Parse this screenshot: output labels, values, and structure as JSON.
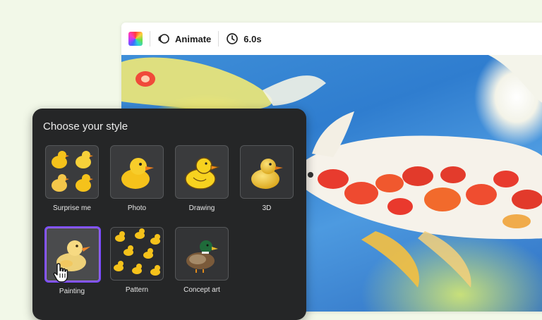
{
  "toolbar": {
    "animate_label": "Animate",
    "duration_label": "6.0s"
  },
  "panel": {
    "title": "Choose your style",
    "styles": [
      {
        "label": "Surprise me",
        "icon": "duck-collage-icon",
        "selected": false
      },
      {
        "label": "Photo",
        "icon": "photo-duck-icon",
        "selected": false
      },
      {
        "label": "Drawing",
        "icon": "drawn-duck-icon",
        "selected": false
      },
      {
        "label": "3D",
        "icon": "3d-duck-icon",
        "selected": false
      },
      {
        "label": "Painting",
        "icon": "painted-duck-icon",
        "selected": true
      },
      {
        "label": "Pattern",
        "icon": "duck-pattern-icon",
        "selected": false
      },
      {
        "label": "Concept art",
        "icon": "mallard-icon",
        "selected": false
      }
    ]
  },
  "colors": {
    "selection": "#7c4dff",
    "panel_bg": "#252627",
    "duck_yellow": "#f5c21b"
  }
}
